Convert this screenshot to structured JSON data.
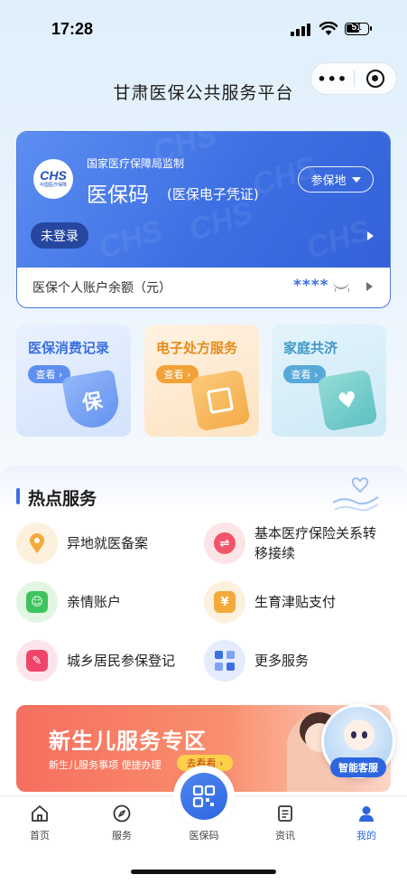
{
  "status_bar": {
    "time": "17:28",
    "battery": "51"
  },
  "nav": {
    "title": "甘肃医保公共服务平台",
    "more_icon": "more-dots-icon",
    "target_icon": "target-icon"
  },
  "card": {
    "logo_text": "CHS",
    "logo_sub": "中国医疗保障",
    "supervision": "国家医疗保障局监制",
    "title": "医保码",
    "subtitle": "(医保电子凭证)",
    "region_button": "参保地",
    "login_status": "未登录",
    "balance_label": "医保个人账户余额（元）",
    "balance_masked": "****",
    "watermark": "CHS"
  },
  "quick_tiles": [
    {
      "title": "医保消费记录",
      "button": "查看 ›",
      "deco_text": "保"
    },
    {
      "title": "电子处方服务",
      "button": "查看 ›"
    },
    {
      "title": "家庭共济",
      "button": "查看 ›",
      "deco_text": "♥"
    }
  ],
  "hot_services": {
    "title": "热点服务",
    "items": [
      {
        "label": "异地就医备案",
        "icon": "location-pin-icon"
      },
      {
        "label": "基本医疗保险关系转移接续",
        "label_line1": "基本医疗保险关系转",
        "label_line2": "移接续",
        "icon": "transfer-icon",
        "glyph": "⇌"
      },
      {
        "label": "亲情账户",
        "icon": "family-account-icon"
      },
      {
        "label": "生育津贴支付",
        "icon": "maternity-allowance-icon",
        "glyph": "¥"
      },
      {
        "label": "城乡居民参保登记",
        "icon": "registration-icon"
      },
      {
        "label": "更多服务",
        "icon": "more-services-icon"
      }
    ]
  },
  "banner": {
    "title": "新生儿服务专区",
    "subtitle": "新生儿服务事项 便捷办理",
    "button": "去看看 ›"
  },
  "assistant": {
    "label": "智能客服"
  },
  "tab_bar": {
    "tabs": [
      {
        "label": "首页",
        "icon": "home-icon"
      },
      {
        "label": "服务",
        "icon": "compass-icon"
      },
      {
        "label": "医保码",
        "icon": "qr-code-icon"
      },
      {
        "label": "资讯",
        "icon": "news-icon"
      },
      {
        "label": "我的",
        "icon": "profile-icon"
      }
    ],
    "active": "我的"
  },
  "colors": {
    "primary": "#3d6fe3",
    "orange": "#f2a236",
    "teal": "#57a9d8",
    "banner": "#f66f5f"
  }
}
